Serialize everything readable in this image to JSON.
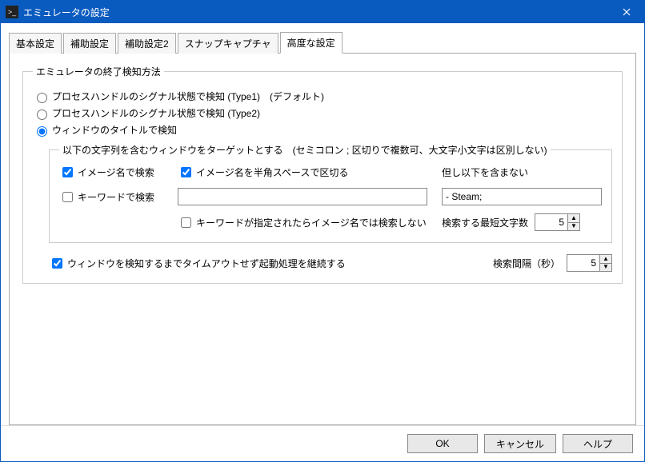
{
  "window": {
    "title": "エミュレータの設定"
  },
  "tabs": [
    {
      "label": "基本設定"
    },
    {
      "label": "補助設定"
    },
    {
      "label": "補助設定2"
    },
    {
      "label": "スナップキャプチャ"
    },
    {
      "label": "高度な設定"
    }
  ],
  "active_tab_index": 4,
  "groupbox": {
    "legend": "エミュレータの終了検知方法",
    "radios": [
      {
        "label": "プロセスハンドルのシグナル状態で検知 (Type1)　(デフォルト)",
        "checked": false
      },
      {
        "label": "プロセスハンドルのシグナル状態で検知 (Type2)",
        "checked": false
      },
      {
        "label": "ウィンドウのタイトルで検知",
        "checked": true
      }
    ],
    "inner": {
      "legend": "以下の文字列を含むウィンドウをターゲットとする　(セミコロン ; 区切りで複数可、大文字小文字は区別しない)",
      "cb_search_by_image": {
        "label": "イメージ名で検索",
        "checked": true
      },
      "cb_image_space_sep": {
        "label": "イメージ名を半角スペースで区切る",
        "checked": true
      },
      "exclude_label": "但し以下を含まない",
      "cb_keyword": {
        "label": "キーワードで検索",
        "checked": false
      },
      "keyword_value": "",
      "exclude_value": "- Steam;",
      "cb_no_image_if_keyword": {
        "label": "キーワードが指定されたらイメージ名では検索しない",
        "checked": false
      },
      "minlen_label": "検索する最短文字数",
      "minlen_value": "5"
    },
    "cb_continue": {
      "label": "ウィンドウを検知するまでタイムアウトせず起動処理を継続する",
      "checked": true
    },
    "interval_label": "検索間隔（秒）",
    "interval_value": "5"
  },
  "buttons": {
    "ok": "OK",
    "cancel": "キャンセル",
    "help": "ヘルプ"
  }
}
